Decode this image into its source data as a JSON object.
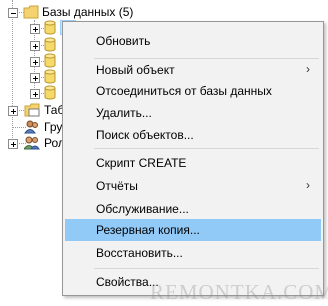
{
  "tree": {
    "databases_label": "Базы данных (5)",
    "tables_label": "Таб",
    "groups_label": "Гру",
    "roles_label": "Рол"
  },
  "menu": {
    "items": [
      {
        "label": "Обновить"
      },
      {
        "label": "Новый объект",
        "submenu": true
      },
      {
        "label": "Отсоединиться от базы данных"
      },
      {
        "label": "Удалить..."
      },
      {
        "label": "Поиск объектов..."
      },
      {
        "label": "Скрипт CREATE"
      },
      {
        "label": "Отчёты",
        "submenu": true
      },
      {
        "label": "Обслуживание..."
      },
      {
        "label": "Резервная копия...",
        "highlighted": true
      },
      {
        "label": "Восстановить..."
      },
      {
        "label": "Свойства..."
      }
    ],
    "submenu_arrow": "›",
    "highlight_color": "#91c9f7"
  },
  "watermark": "REMONTKA.COM"
}
